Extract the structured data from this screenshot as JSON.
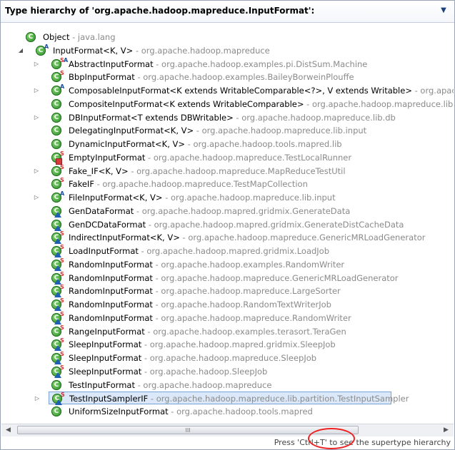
{
  "header": {
    "title": "Type hierarchy of 'org.apache.hadoop.mapreduce.InputFormat':",
    "menu_icon": "chevron-down-icon"
  },
  "tree": [
    {
      "name": "Object",
      "pkg": " - java.lang",
      "level": 0,
      "expand": "",
      "icon": "class",
      "overlay": ""
    },
    {
      "name": "InputFormat<K, V>",
      "pkg": " - org.apache.hadoop.mapreduce",
      "level": 1,
      "expand": "open",
      "icon": "class-nob",
      "overlay": "a"
    },
    {
      "name": "AbstractInputFormat",
      "pkg": " - org.apache.hadoop.examples.pi.DistSum.Machine",
      "level": 2,
      "expand": "closed",
      "icon": "class",
      "overlay": "sa"
    },
    {
      "name": "BbpInputFormat",
      "pkg": " - org.apache.hadoop.examples.BaileyBorweinPlouffe",
      "level": 2,
      "expand": "",
      "icon": "class",
      "overlay": "s"
    },
    {
      "name": "ComposableInputFormat<K extends WritableComparable<?>, V extends Writable>",
      "pkg": " - org.apache",
      "level": 2,
      "expand": "closed",
      "icon": "class",
      "overlay": "a"
    },
    {
      "name": "CompositeInputFormat<K extends WritableComparable>",
      "pkg": " - org.apache.hadoop.mapreduce.lib.join",
      "level": 2,
      "expand": "",
      "icon": "class",
      "overlay": ""
    },
    {
      "name": "DBInputFormat<T extends DBWritable>",
      "pkg": " - org.apache.hadoop.mapreduce.lib.db",
      "level": 2,
      "expand": "closed",
      "icon": "class",
      "overlay": ""
    },
    {
      "name": "DelegatingInputFormat<K, V>",
      "pkg": " - org.apache.hadoop.mapreduce.lib.input",
      "level": 2,
      "expand": "",
      "icon": "class",
      "overlay": ""
    },
    {
      "name": "DynamicInputFormat<K, V>",
      "pkg": " - org.apache.hadoop.tools.mapred.lib",
      "level": 2,
      "expand": "",
      "icon": "class",
      "overlay": ""
    },
    {
      "name": "EmptyInputFormat",
      "pkg": " - org.apache.hadoop.mapreduce.TestLocalRunner",
      "level": 2,
      "expand": "",
      "icon": "class",
      "overlay": "sq"
    },
    {
      "name": "Fake_IF<K, V>",
      "pkg": " - org.apache.hadoop.mapreduce.MapReduceTestUtil",
      "level": 2,
      "expand": "closed",
      "icon": "class",
      "overlay": "s"
    },
    {
      "name": "FakeIF",
      "pkg": " - org.apache.hadoop.mapreduce.TestMapCollection",
      "level": 2,
      "expand": "",
      "icon": "class",
      "overlay": "s"
    },
    {
      "name": "FileInputFormat<K, V>",
      "pkg": " - org.apache.hadoop.mapreduce.lib.input",
      "level": 2,
      "expand": "closed",
      "icon": "class",
      "overlay": "a"
    },
    {
      "name": "GenDataFormat",
      "pkg": " - org.apache.hadoop.mapred.gridmix.GenerateData",
      "level": 2,
      "expand": "",
      "icon": "class",
      "overlay": "tri"
    },
    {
      "name": "GenDCDataFormat",
      "pkg": " - org.apache.hadoop.mapred.gridmix.GenerateDistCacheData",
      "level": 2,
      "expand": "",
      "icon": "class",
      "overlay": "tri"
    },
    {
      "name": "IndirectInputFormat<K, V>",
      "pkg": " - org.apache.hadoop.mapreduce.GenericMRLoadGenerator",
      "level": 2,
      "expand": "",
      "icon": "class",
      "overlay": "s-tri"
    },
    {
      "name": "LoadInputFormat",
      "pkg": " - org.apache.hadoop.mapred.gridmix.LoadJob",
      "level": 2,
      "expand": "",
      "icon": "class",
      "overlay": "s-tri"
    },
    {
      "name": "RandomInputFormat",
      "pkg": " - org.apache.hadoop.examples.RandomWriter",
      "level": 2,
      "expand": "",
      "icon": "class",
      "overlay": "s-tri"
    },
    {
      "name": "RandomInputFormat",
      "pkg": " - org.apache.hadoop.mapreduce.GenericMRLoadGenerator",
      "level": 2,
      "expand": "",
      "icon": "class",
      "overlay": "s-tri"
    },
    {
      "name": "RandomInputFormat",
      "pkg": " - org.apache.hadoop.mapreduce.LargeSorter",
      "level": 2,
      "expand": "",
      "icon": "class",
      "overlay": "s-tri"
    },
    {
      "name": "RandomInputFormat",
      "pkg": " - org.apache.hadoop.RandomTextWriterJob",
      "level": 2,
      "expand": "",
      "icon": "class",
      "overlay": "s-tri"
    },
    {
      "name": "RandomInputFormat",
      "pkg": " - org.apache.hadoop.mapreduce.RandomWriter",
      "level": 2,
      "expand": "",
      "icon": "class",
      "overlay": "s-tri"
    },
    {
      "name": "RangeInputFormat",
      "pkg": " - org.apache.hadoop.examples.terasort.TeraGen",
      "level": 2,
      "expand": "",
      "icon": "class",
      "overlay": "s"
    },
    {
      "name": "SleepInputFormat",
      "pkg": " - org.apache.hadoop.mapred.gridmix.SleepJob",
      "level": 2,
      "expand": "",
      "icon": "class",
      "overlay": "s-tri"
    },
    {
      "name": "SleepInputFormat",
      "pkg": " - org.apache.hadoop.mapreduce.SleepJob",
      "level": 2,
      "expand": "",
      "icon": "class",
      "overlay": "s-tri"
    },
    {
      "name": "SleepInputFormat",
      "pkg": " - org.apache.hadoop.SleepJob",
      "level": 2,
      "expand": "",
      "icon": "class",
      "overlay": "s-tri"
    },
    {
      "name": "TestInputFormat",
      "pkg": " - org.apache.hadoop.mapreduce",
      "level": 2,
      "expand": "",
      "icon": "class",
      "overlay": ""
    },
    {
      "name": "TestInputSamplerIF",
      "pkg": " - org.apache.hadoop.mapreduce.lib.partition.TestInputSampler",
      "level": 2,
      "expand": "closed",
      "icon": "class",
      "overlay": "s-tri",
      "selected": true
    },
    {
      "name": "UniformSizeInputFormat",
      "pkg": " - org.apache.hadoop.tools.mapred",
      "level": 2,
      "expand": "",
      "icon": "class",
      "overlay": ""
    }
  ],
  "scrollbar": {
    "left_icon": "arrow-left-icon",
    "right_icon": "arrow-right-icon",
    "thumb_grip": "III"
  },
  "footer": {
    "hint": "Press 'Ctrl+T' to see the supertype hierarchy"
  }
}
